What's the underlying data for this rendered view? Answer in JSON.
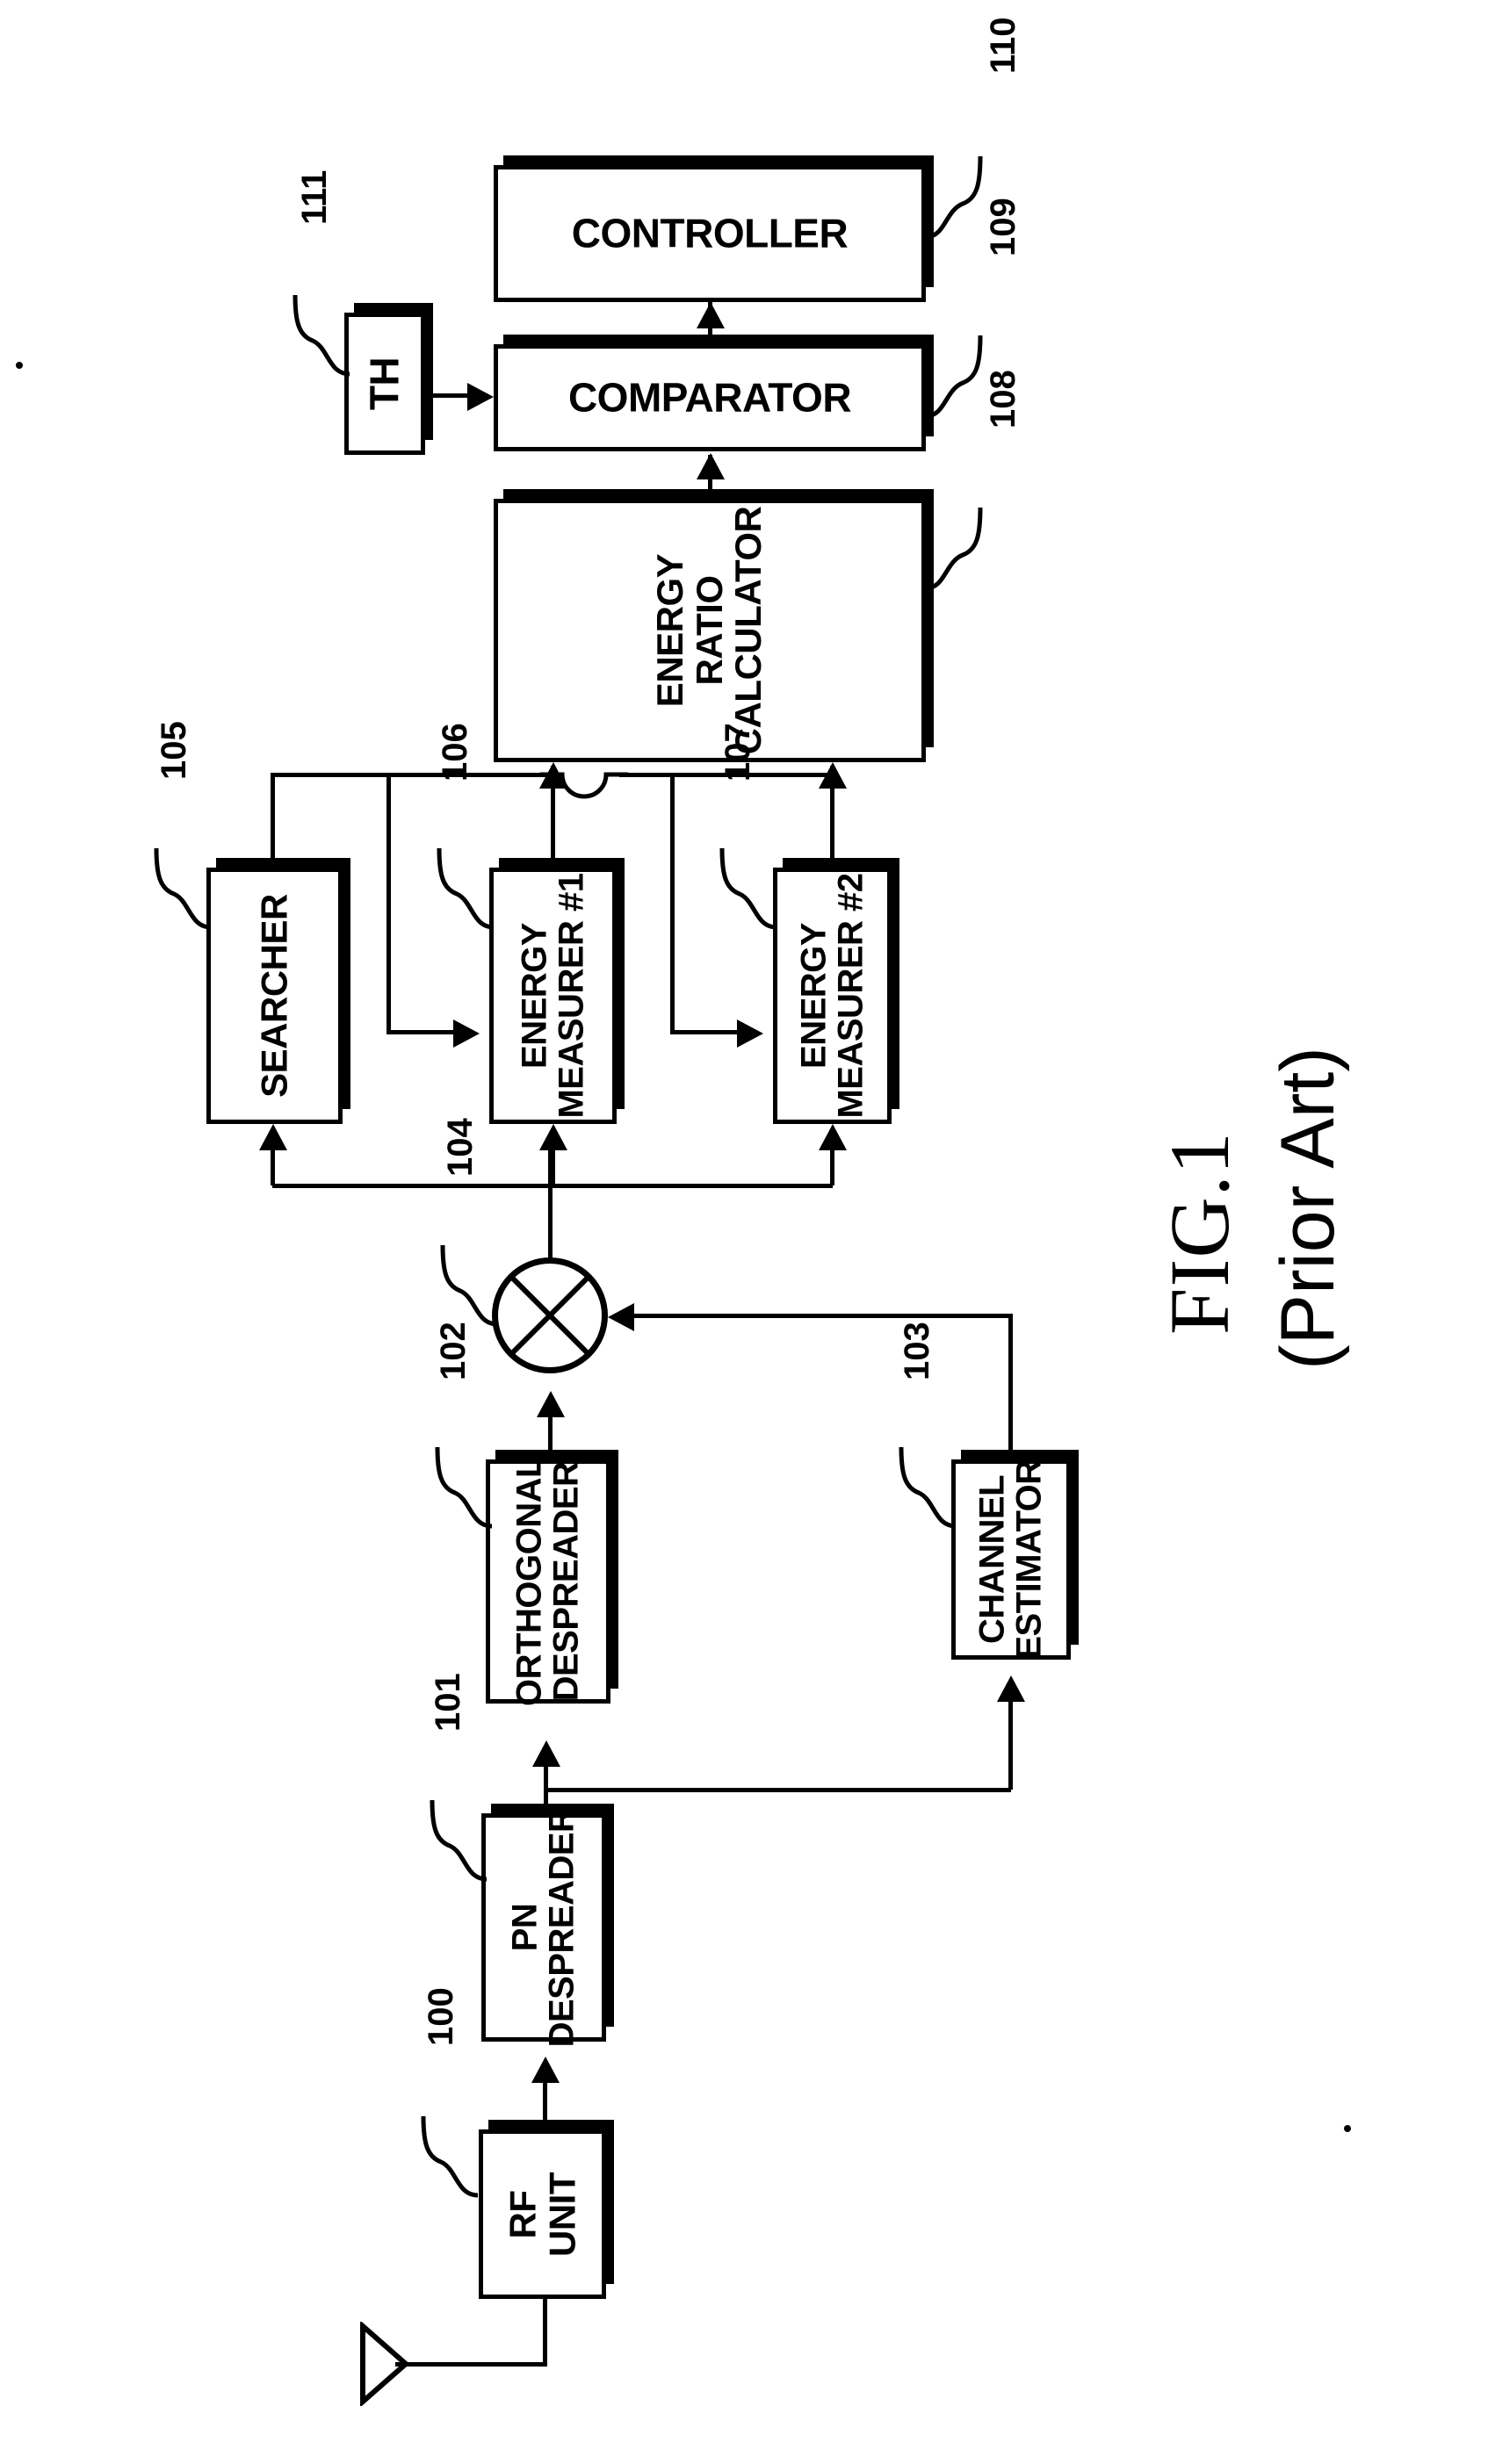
{
  "figure": {
    "caption": "FIG.1",
    "subcaption": "(Prior Art)"
  },
  "blocks": [
    {
      "id": "rf-unit",
      "label": "RF\nUNIT",
      "ref": "100"
    },
    {
      "id": "pn-despreader",
      "label": "PN\nDESPREADER",
      "ref": "101"
    },
    {
      "id": "orthogonal-despreader",
      "label": "ORTHOGONAL\nDESPREADER",
      "ref": "102"
    },
    {
      "id": "channel-estimator",
      "label": "CHANNEL\nESTIMATOR",
      "ref": "103"
    },
    {
      "id": "multiplier",
      "label": "",
      "ref": "104"
    },
    {
      "id": "searcher",
      "label": "SEARCHER",
      "ref": "105"
    },
    {
      "id": "energy-measurer-1",
      "label": "ENERGY\nMEASURER #1",
      "ref": "106"
    },
    {
      "id": "energy-measurer-2",
      "label": "ENERGY\nMEASURER #2",
      "ref": "107"
    },
    {
      "id": "energy-ratio-calculator",
      "label": "ENERGY\nRATIO\nCALCULATOR",
      "ref": "108"
    },
    {
      "id": "comparator",
      "label": "COMPARATOR",
      "ref": "109"
    },
    {
      "id": "controller",
      "label": "CONTROLLER",
      "ref": "110"
    },
    {
      "id": "threshold",
      "label": "TH",
      "ref": "111"
    }
  ],
  "labels": {
    "rf_unit_line1": "RF",
    "rf_unit_line2": "UNIT",
    "pn_despreader_line1": "PN",
    "pn_despreader_line2": "DESPREADER",
    "orthogonal_despreader_line1": "ORTHOGONAL",
    "orthogonal_despreader_line2": "DESPREADER",
    "channel_estimator_line1": "CHANNEL",
    "channel_estimator_line2": "ESTIMATOR",
    "searcher": "SEARCHER",
    "energy_measurer_1_line1": "ENERGY",
    "energy_measurer_1_line2": "MEASURER #1",
    "energy_measurer_2_line1": "ENERGY",
    "energy_measurer_2_line2": "MEASURER #2",
    "energy_ratio_calculator_line1": "ENERGY",
    "energy_ratio_calculator_line2": "RATIO",
    "energy_ratio_calculator_line3": "CALCULATOR",
    "comparator": "COMPARATOR",
    "controller": "CONTROLLER",
    "threshold": "TH"
  },
  "refs": {
    "rf_unit": "100",
    "pn_despreader": "101",
    "orthogonal_despreader": "102",
    "channel_estimator": "103",
    "multiplier": "104",
    "searcher": "105",
    "energy_measurer_1": "106",
    "energy_measurer_2": "107",
    "energy_ratio_calculator": "108",
    "comparator": "109",
    "controller": "110",
    "threshold": "111"
  },
  "icons": {
    "antenna": "antenna-icon",
    "multiplier": "multiplier-circle-icon",
    "wire_hop": "wire-hop-icon"
  },
  "colors": {
    "ink": "#000000",
    "paper": "#ffffff"
  }
}
